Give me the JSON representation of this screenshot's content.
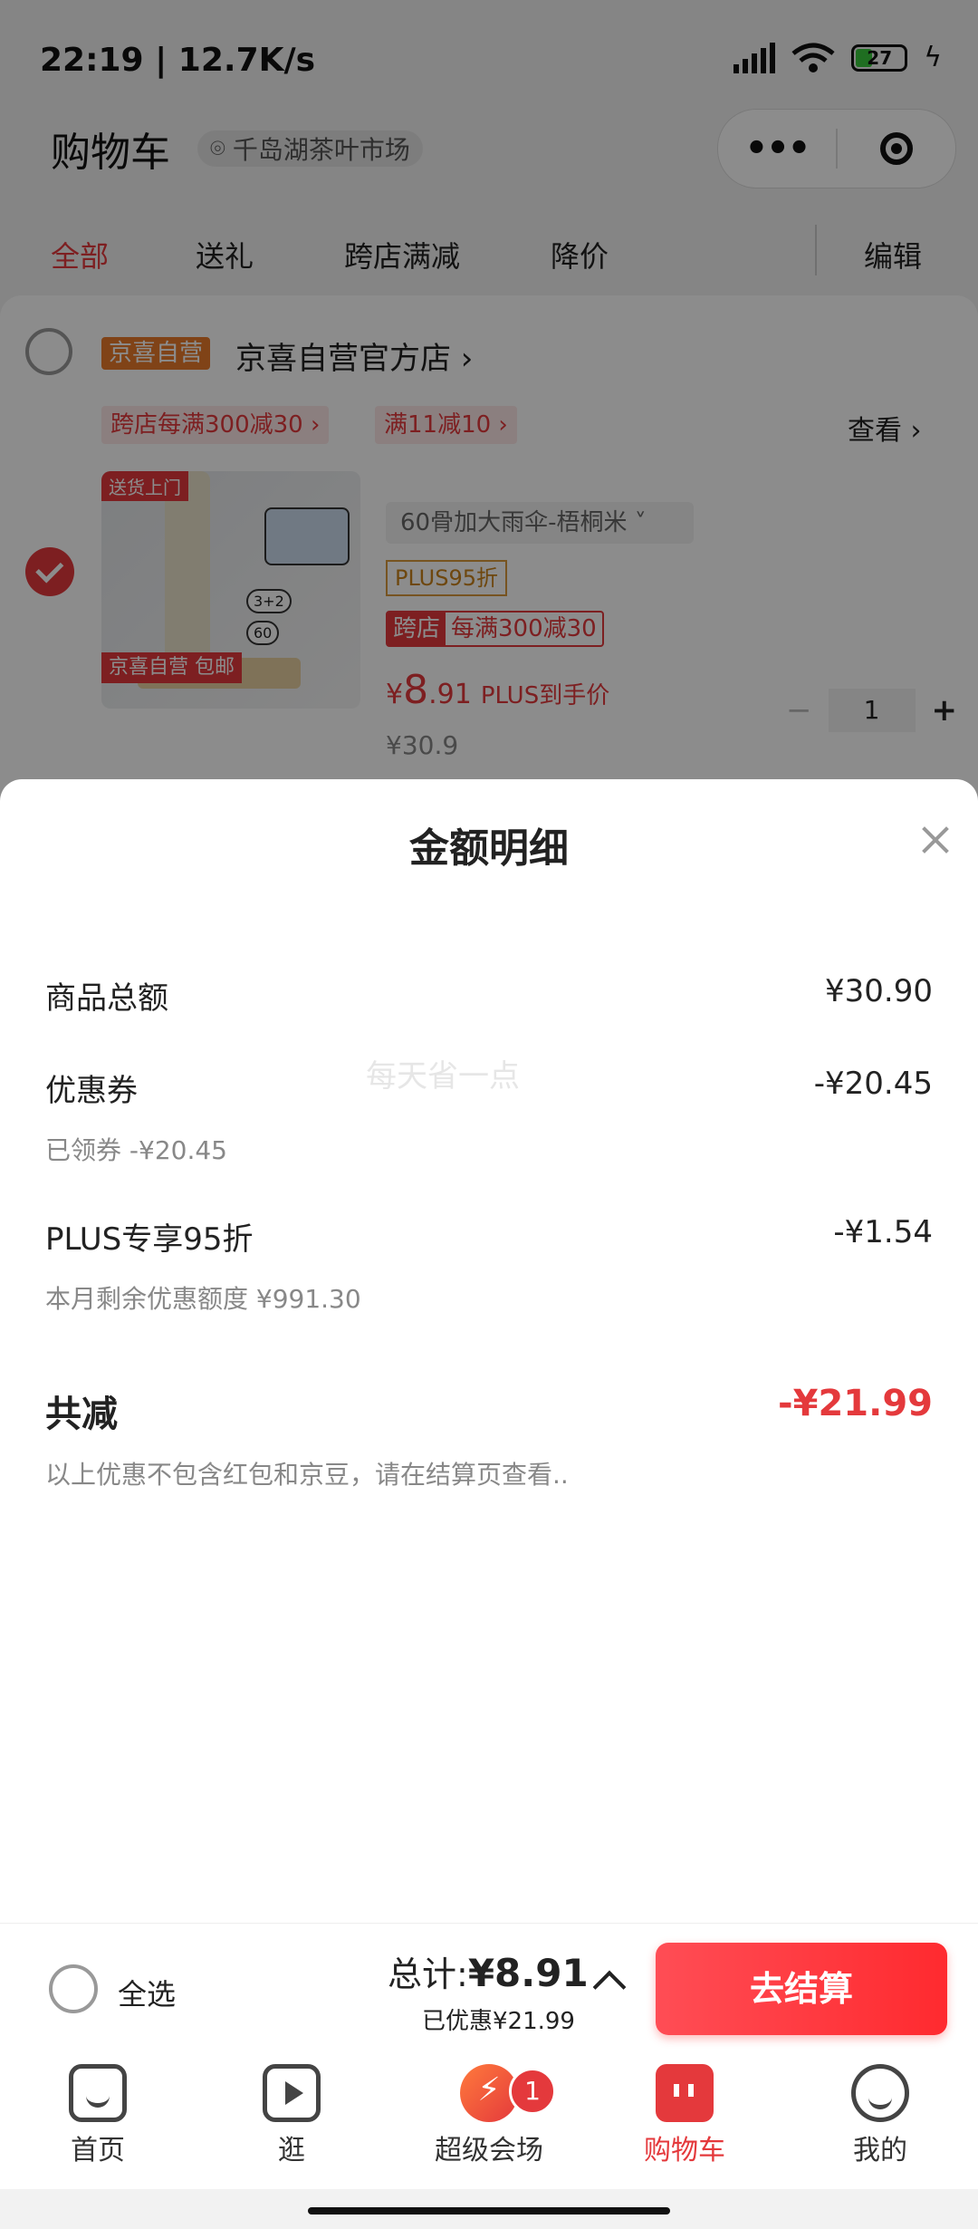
{
  "status_bar": {
    "time": "22:19 | 12.7K/s",
    "battery": "27"
  },
  "header": {
    "title": "购物车",
    "location": "千岛湖茶叶市场"
  },
  "tabs": [
    {
      "label": "全部",
      "active": true
    },
    {
      "label": "送礼",
      "active": false
    },
    {
      "label": "跨店满减",
      "active": false
    },
    {
      "label": "降价",
      "active": false
    }
  ],
  "edit_label": "编辑",
  "shop": {
    "badge": "京喜自营",
    "name": "京喜自营官方店 ›",
    "promos": [
      "跨店每满300减30 ›",
      "满11减10 ›"
    ],
    "view_label": "查看 ›"
  },
  "item": {
    "image_tags": [
      "送货上门",
      "京喜自营 包邮"
    ],
    "spec": "60骨加大雨伞-梧桐米 ˅",
    "plus_tag": "PLUS95折",
    "cross_tag_a": "跨店",
    "cross_tag_b": "每满300减30",
    "price_currency": "¥",
    "price_int": "8",
    "price_dec": ".91",
    "price_note": "PLUS到手价",
    "original_price": "¥30.9",
    "quantity": "1",
    "minus": "−",
    "plus": "+"
  },
  "sheet": {
    "title": "金额明细",
    "watermark": "每天省一点",
    "rows": [
      {
        "label": "商品总额",
        "value": "¥30.90",
        "sub": ""
      },
      {
        "label": "优惠券",
        "value": "-¥20.45",
        "sub": "已领券 -¥20.45"
      },
      {
        "label": "PLUS专享95折",
        "value": "-¥1.54",
        "sub": "本月剩余优惠额度 ¥991.30"
      }
    ],
    "total_label": "共减",
    "total_value": "-¥21.99",
    "note": "以上优惠不包含红包和京豆，请在结算页查看.."
  },
  "checkout": {
    "select_all": "全选",
    "total_label": "总计:",
    "total_amount": "¥8.91",
    "saved": "已优惠¥21.99",
    "button": "去结算"
  },
  "tabbar": [
    {
      "label": "首页",
      "icon": "home-icon",
      "active": false
    },
    {
      "label": "逛",
      "icon": "video-icon",
      "active": false
    },
    {
      "label": "超级会场",
      "icon": "venue-icon",
      "active": false
    },
    {
      "label": "购物车",
      "icon": "cart-icon",
      "active": true
    },
    {
      "label": "我的",
      "icon": "me-icon",
      "active": false
    }
  ],
  "tabbar_badge": "1",
  "colors": {
    "accent": "#e4393c",
    "plus_gold": "#c9821a",
    "orange_badge": "#e97a2a"
  }
}
